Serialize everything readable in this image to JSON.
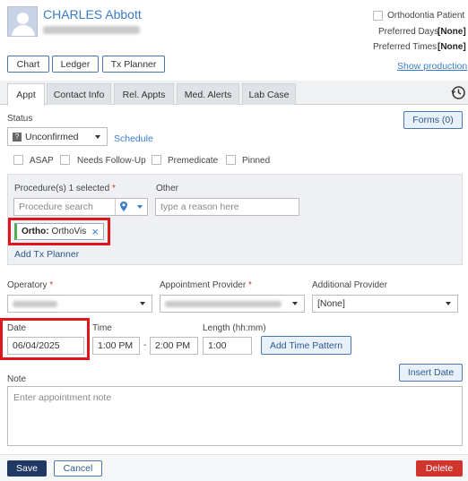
{
  "patient": {
    "name": "CHARLES Abbott"
  },
  "ortho": {
    "label": "Orthodontia Patient",
    "preferred_days_label": "Preferred Days",
    "preferred_days_value": "[None]",
    "preferred_times_label": "Preferred Times",
    "preferred_times_value": "[None]",
    "show_production": "Show production"
  },
  "top_buttons": {
    "chart": "Chart",
    "ledger": "Ledger",
    "tx_planner": "Tx Planner"
  },
  "tabs": [
    {
      "label": "Appt"
    },
    {
      "label": "Contact Info"
    },
    {
      "label": "Rel. Appts"
    },
    {
      "label": "Med. Alerts"
    },
    {
      "label": "Lab Case"
    }
  ],
  "status": {
    "label": "Status",
    "value": "Unconfirmed",
    "icon_glyph": "?",
    "schedule": "Schedule",
    "forms": "Forms (0)"
  },
  "flags": [
    {
      "label": "ASAP"
    },
    {
      "label": "Needs Follow-Up"
    },
    {
      "label": "Premedicate"
    },
    {
      "label": "Pinned"
    }
  ],
  "procedure": {
    "label": "Procedure(s)",
    "selected": "1 selected",
    "asterisk": "*",
    "search_placeholder": "Procedure search",
    "other_label": "Other",
    "other_placeholder": "type a reason here",
    "chip_bold": "Ortho:",
    "chip_text": "OrthoVis",
    "add_tx": "Add Tx Planner"
  },
  "operatory": {
    "label": "Operatory",
    "asterisk": "*"
  },
  "provider": {
    "label": "Appointment Provider",
    "asterisk": "*"
  },
  "additional_provider": {
    "label": "Additional Provider",
    "value": "[None]"
  },
  "date": {
    "label": "Date",
    "value": "06/04/2025"
  },
  "time": {
    "label": "Time",
    "start": "1:00 PM",
    "separator": "-",
    "end": "2:00 PM"
  },
  "length": {
    "label": "Length (hh:mm)",
    "value": "1:00"
  },
  "add_time_pattern": "Add Time Pattern",
  "note": {
    "label": "Note",
    "insert_date": "Insert Date",
    "placeholder": "Enter appointment note"
  },
  "footer": {
    "save": "Save",
    "cancel": "Cancel",
    "delete": "Delete"
  },
  "colors": {
    "accent": "#3a7cc7",
    "highlight": "#e0151b",
    "save_bg": "#1f3864",
    "delete_bg": "#d0342c"
  }
}
